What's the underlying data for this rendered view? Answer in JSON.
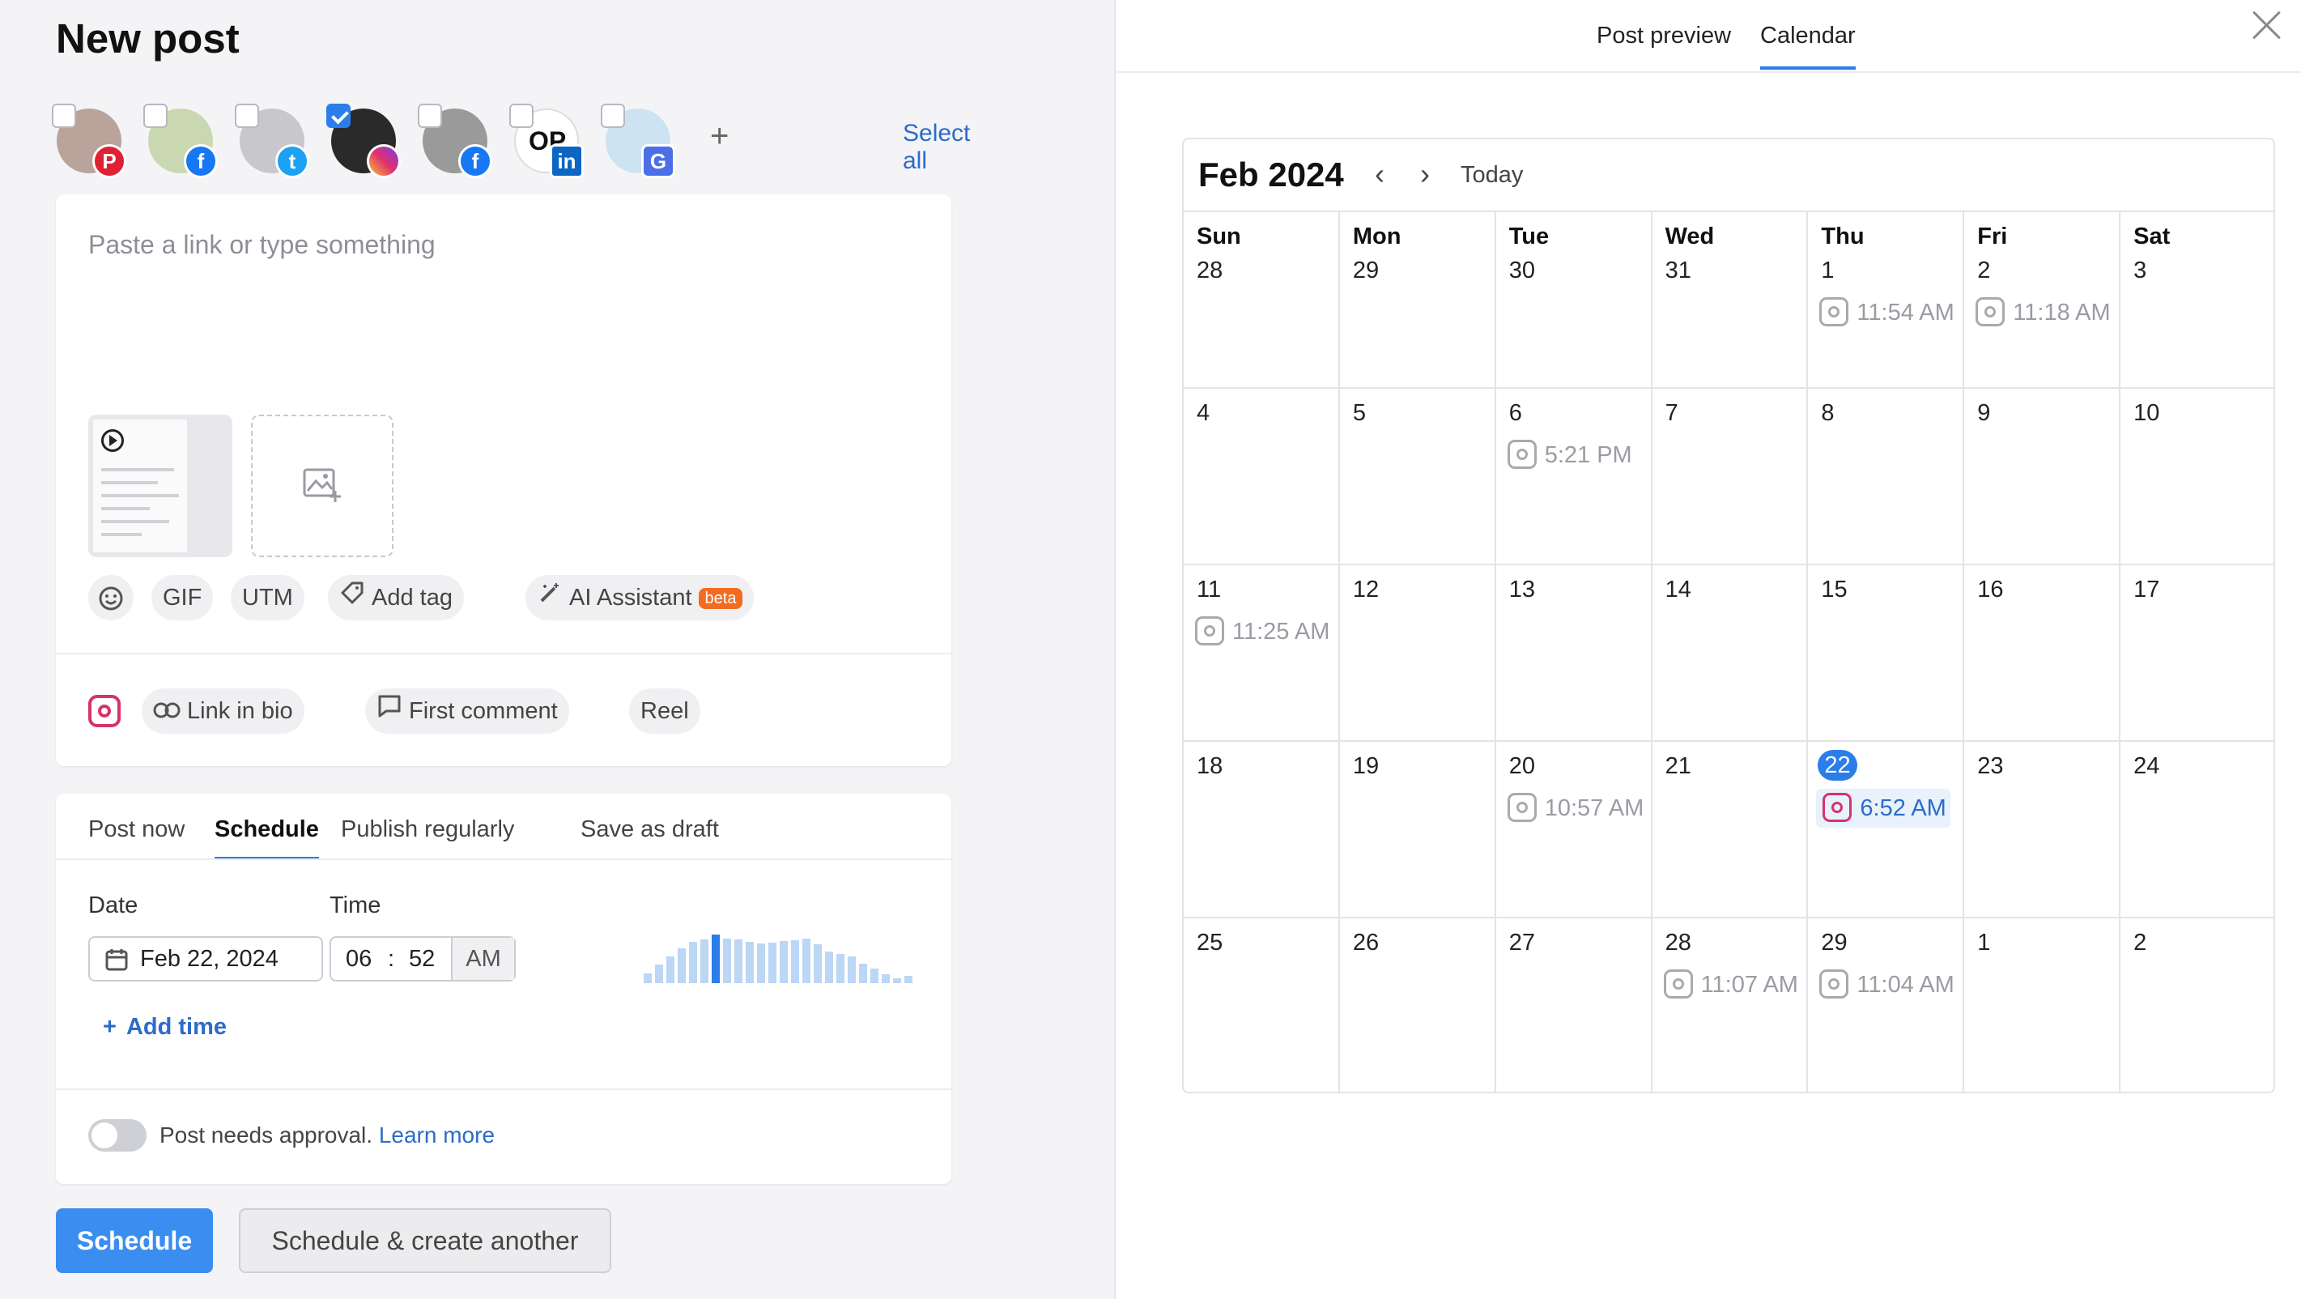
{
  "left": {
    "title": "New post",
    "select_all": "Select all",
    "accounts": [
      {
        "network": "pinterest",
        "checked": false,
        "badge": "P"
      },
      {
        "network": "facebook",
        "checked": false,
        "badge": "f"
      },
      {
        "network": "twitter",
        "checked": false,
        "badge": "t"
      },
      {
        "network": "instagram",
        "checked": true,
        "badge": ""
      },
      {
        "network": "facebook",
        "checked": false,
        "badge": "f"
      },
      {
        "network": "linkedin",
        "checked": false,
        "badge": "in",
        "initials": "OP"
      },
      {
        "network": "google-business",
        "checked": false,
        "badge": "G"
      }
    ],
    "compose": {
      "placeholder": "Paste a link or type something",
      "tools": {
        "gif": "GIF",
        "utm": "UTM",
        "add_tag": "Add tag",
        "ai": "AI Assistant",
        "beta": "beta"
      },
      "ig_options": {
        "link_in_bio": "Link in bio",
        "first_comment": "First comment",
        "reel": "Reel"
      }
    },
    "schedule": {
      "tabs": [
        "Post now",
        "Schedule",
        "Publish regularly",
        "Save as draft"
      ],
      "active_tab": "Schedule",
      "date_label": "Date",
      "time_label": "Time",
      "date_value": "Feb 22, 2024",
      "hour": "06",
      "minute": "52",
      "ampm": "AM",
      "add_time": "Add time",
      "approval_text": "Post needs approval.",
      "learn_more": "Learn more",
      "activity_levels": [
        0.2,
        0.38,
        0.55,
        0.72,
        0.85,
        0.9,
        1.0,
        0.92,
        0.9,
        0.85,
        0.82,
        0.84,
        0.86,
        0.88,
        0.92,
        0.8,
        0.65,
        0.6,
        0.55,
        0.4,
        0.3,
        0.18,
        0.1,
        0.15
      ],
      "selected_bar": 6
    },
    "buttons": {
      "schedule": "Schedule",
      "schedule_another": "Schedule & create another"
    }
  },
  "right": {
    "tabs": {
      "preview": "Post preview",
      "calendar": "Calendar"
    },
    "calendar": {
      "month": "Feb 2024",
      "prev": "‹",
      "next": "›",
      "today": "Today",
      "weekdays": [
        "Sun",
        "Mon",
        "Tue",
        "Wed",
        "Thu",
        "Fri",
        "Sat"
      ],
      "weeks": [
        [
          {
            "d": "28"
          },
          {
            "d": "29"
          },
          {
            "d": "30"
          },
          {
            "d": "31"
          },
          {
            "d": "1",
            "ev": "11:54 AM"
          },
          {
            "d": "2",
            "ev": "11:18 AM"
          },
          {
            "d": "3"
          }
        ],
        [
          {
            "d": "4"
          },
          {
            "d": "5"
          },
          {
            "d": "6",
            "ev": "5:21 PM"
          },
          {
            "d": "7"
          },
          {
            "d": "8"
          },
          {
            "d": "9"
          },
          {
            "d": "10"
          }
        ],
        [
          {
            "d": "11",
            "ev": "11:25 AM"
          },
          {
            "d": "12"
          },
          {
            "d": "13"
          },
          {
            "d": "14"
          },
          {
            "d": "15"
          },
          {
            "d": "16"
          },
          {
            "d": "17"
          }
        ],
        [
          {
            "d": "18"
          },
          {
            "d": "19"
          },
          {
            "d": "20",
            "ev": "10:57 AM"
          },
          {
            "d": "21"
          },
          {
            "d": "22",
            "ev": "6:52 AM",
            "today": true,
            "active": true
          },
          {
            "d": "23"
          },
          {
            "d": "24"
          }
        ],
        [
          {
            "d": "25"
          },
          {
            "d": "26"
          },
          {
            "d": "27"
          },
          {
            "d": "28",
            "ev": "11:07 AM"
          },
          {
            "d": "29",
            "ev": "11:04 AM"
          },
          {
            "d": "1"
          },
          {
            "d": "2"
          }
        ]
      ]
    }
  }
}
